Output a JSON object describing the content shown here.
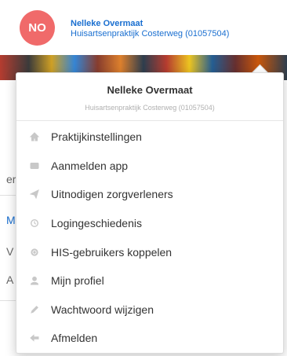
{
  "header": {
    "avatar_initials": "NO",
    "user_name": "Nelleke Overmaat",
    "practice": "Huisartsenpraktijk Costerweg (01057504)"
  },
  "background_fragments": {
    "frag_1": "er",
    "frag_2": "M",
    "frag_3": "V",
    "frag_4": "A"
  },
  "dropdown": {
    "name": "Nelleke Overmaat",
    "practice": "Huisartsenpraktijk Costerweg (01057504)",
    "items": [
      {
        "label": "Praktijkinstellingen",
        "icon": "home-icon"
      },
      {
        "label": "Aanmelden app",
        "icon": "card-icon"
      },
      {
        "label": "Uitnodigen zorgverleners",
        "icon": "send-icon"
      },
      {
        "label": "Logingeschiedenis",
        "icon": "history-icon"
      },
      {
        "label": "HIS-gebruikers koppelen",
        "icon": "gear-icon"
      },
      {
        "label": "Mijn profiel",
        "icon": "user-icon"
      },
      {
        "label": "Wachtwoord wijzigen",
        "icon": "pencil-icon"
      },
      {
        "label": "Afmelden",
        "icon": "logout-icon"
      }
    ]
  },
  "colors": {
    "avatar_bg": "#f06a6a",
    "link_blue": "#1a6fd0",
    "icon_grey": "#c8c8c8"
  }
}
